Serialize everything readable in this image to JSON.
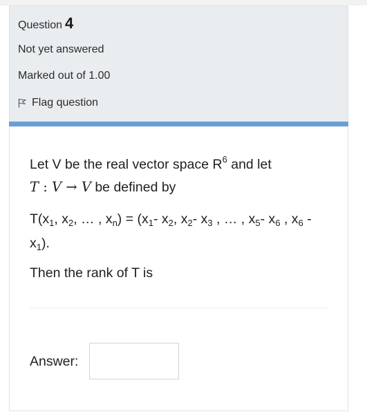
{
  "info": {
    "question_label": "Question",
    "question_number": "4",
    "state": "Not yet answered",
    "grade": "Marked out of 1.00",
    "flag_label": "Flag question"
  },
  "question": {
    "intro_prefix": "Let V be the real vector space R",
    "intro_sup": "6",
    "intro_suffix": " and let",
    "math_T": "T",
    "math_colon": " : ",
    "math_V1": "V",
    "math_arrow": " → ",
    "math_V2": "V",
    "defined_by": " be defined by",
    "mapping": {
      "t_open": "T(x",
      "s1": "1",
      "sep1": ", x",
      "s2": "2",
      "ellipsis": ", … , x",
      "sn": "n",
      "equals": ") = (x",
      "r1": "1",
      "minus1": "- x",
      "r2": "2",
      "comma1": ", x",
      "r3": "2",
      "minus2": "- x",
      "r4": "3",
      "ellipsis2": " , … , x",
      "r5": "5",
      "minus3": "- x",
      "r6": "6",
      "comma2": " , x",
      "r7": "6",
      "minus4": " -",
      "line2_x": "x",
      "line2_sub": "1",
      "line2_end": ")."
    },
    "prompt": "Then the rank of T is"
  },
  "answer": {
    "label": "Answer:",
    "value": ""
  },
  "colors": {
    "info_bg": "#e9edf0",
    "accent_bar": "#6b9fd4"
  }
}
